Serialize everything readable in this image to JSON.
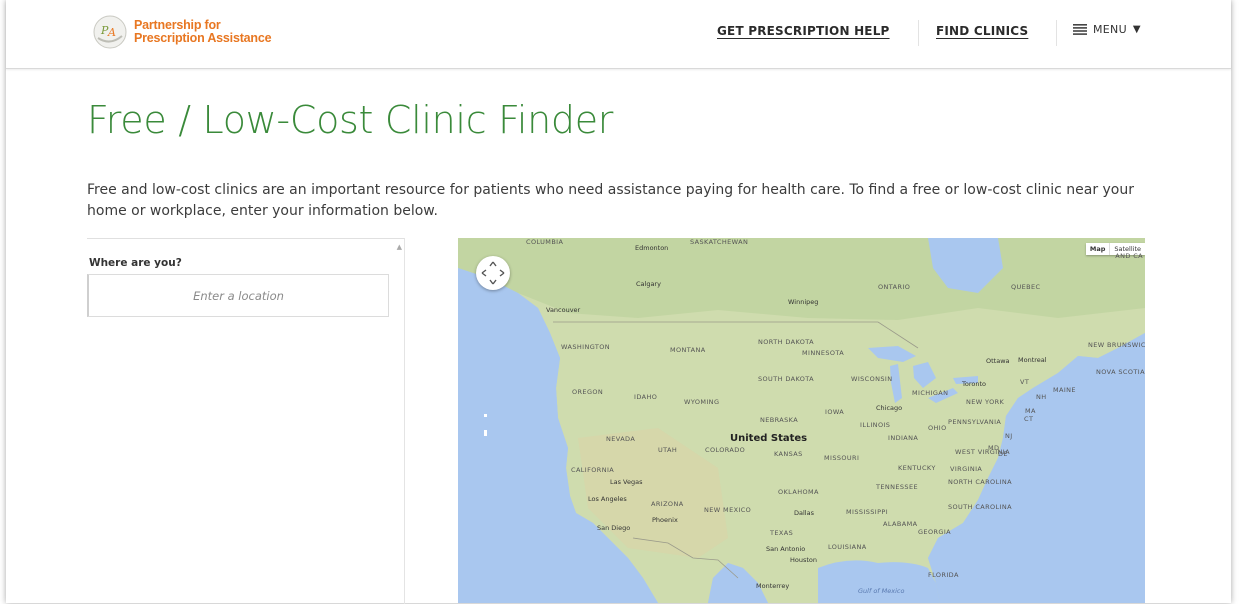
{
  "header": {
    "logo_text_line1": "Partnership for",
    "logo_text_line2": "Prescription Assistance",
    "logo_icon": "ppa-logo-icon",
    "nav": {
      "prescription_help": "GET PRESCRIPTION HELP",
      "find_clinics": "FIND CLINICS",
      "menu": "MENU",
      "menu_icon": "hamburger-icon",
      "caret_icon": "caret-down-icon"
    }
  },
  "main": {
    "title": "Free / Low-Cost Clinic Finder",
    "intro": "Free and low-cost clinics are an important resource for patients who need assistance paying for health care. To find a free or low-cost clinic near your home or workplace, enter your information below."
  },
  "search": {
    "label": "Where are you?",
    "placeholder": "Enter a location"
  },
  "map": {
    "type_buttons": [
      "Map",
      "Satellite"
    ],
    "corner_label": "AND CA",
    "country": "United States",
    "regions": [
      "COLUMBIA",
      "SASKATCHEWAN",
      "ONTARIO",
      "QUEBEC",
      "WASHINGTON",
      "MONTANA",
      "NORTH DAKOTA",
      "MINNESOTA",
      "SOUTH DAKOTA",
      "WISCONSIN",
      "MICHIGAN",
      "OREGON",
      "IDAHO",
      "WYOMING",
      "NEBRASKA",
      "IOWA",
      "ILLINOIS",
      "INDIANA",
      "OHIO",
      "PENNSYLVANIA",
      "NEW YORK",
      "NEVADA",
      "UTAH",
      "COLORADO",
      "KANSAS",
      "MISSOURI",
      "KENTUCKY",
      "WEST VIRGINIA",
      "VIRGINIA",
      "CALIFORNIA",
      "ARIZONA",
      "NEW MEXICO",
      "OKLAHOMA",
      "TENNESSEE",
      "NORTH CAROLINA",
      "SOUTH CAROLINA",
      "MISSISSIPPI",
      "ALABAMA",
      "GEORGIA",
      "TEXAS",
      "LOUISIANA",
      "FLORIDA",
      "NEW BRUNSWICK",
      "NOVA SCOTIA",
      "MAINE",
      "VT",
      "NH",
      "MA",
      "CT",
      "NJ",
      "MD",
      "DE"
    ],
    "cities": [
      "Edmonton",
      "Calgary",
      "Vancouver",
      "Winnipeg",
      "Ottawa",
      "Montreal",
      "Toronto",
      "Chicago",
      "Las Vegas",
      "Los Angeles",
      "Phoenix",
      "San Diego",
      "Dallas",
      "San Antonio",
      "Houston",
      "Monterrey"
    ],
    "water": "Gulf of Mexico"
  },
  "colors": {
    "title_green": "#3a8a3a",
    "logo_orange": "#e87722",
    "water": "#a9c7ef",
    "land": "#cfdcae"
  }
}
